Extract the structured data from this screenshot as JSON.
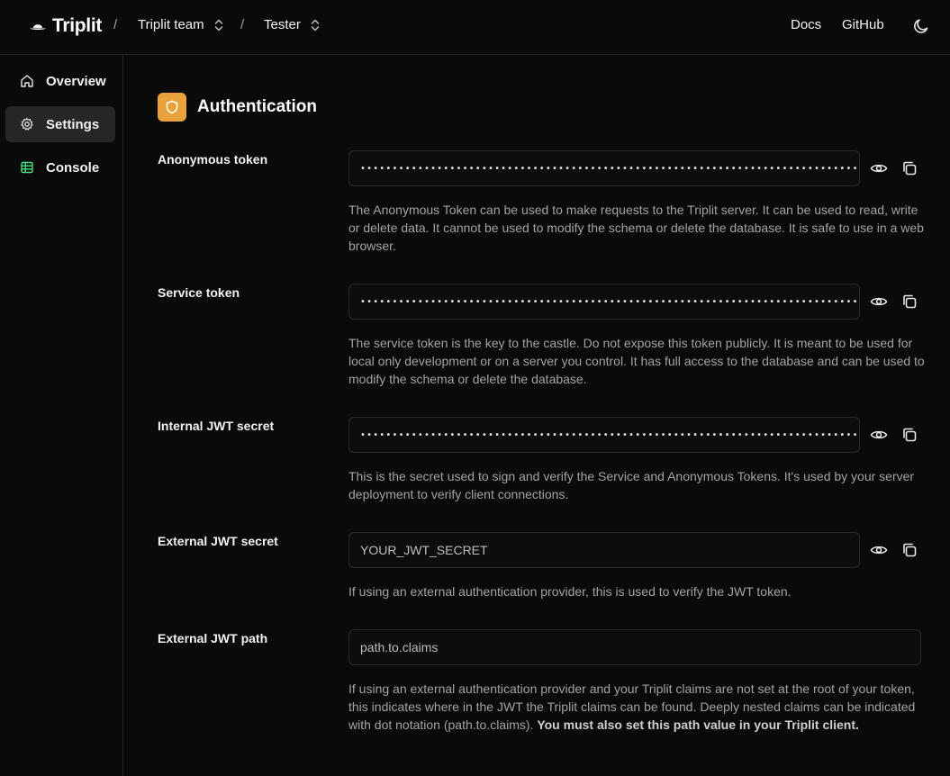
{
  "header": {
    "logo_text": "Triplit",
    "separator": "/",
    "team": "Triplit team",
    "project": "Tester",
    "docs_link": "Docs",
    "github_link": "GitHub"
  },
  "sidebar": {
    "items": [
      {
        "label": "Overview",
        "icon": "home-icon"
      },
      {
        "label": "Settings",
        "icon": "gear-icon",
        "active": true
      },
      {
        "label": "Console",
        "icon": "table-icon"
      }
    ]
  },
  "section": {
    "title": "Authentication",
    "accent_color": "#e9a23b"
  },
  "fields": {
    "anonymous_token": {
      "label": "Anonymous token",
      "masked_value": "••••••••••••••••••••••••••••••••••••••••••••••••••••••••••••••••••••••••••••••••••••••••••••••••••",
      "description": "The Anonymous Token can be used to make requests to the Triplit server. It can be used to read, write or delete data. It cannot be used to modify the schema or delete the database. It is safe to use in a web browser."
    },
    "service_token": {
      "label": "Service token",
      "masked_value": "••••••••••••••••••••••••••••••••••••••••••••••••••••••••••••••••••••••••••••••••••••••••••••••••••",
      "description": "The service token is the key to the castle. Do not expose this token publicly. It is meant to be used for local only development or on a server you control. It has full access to the database and can be used to modify the schema or delete the database."
    },
    "internal_jwt": {
      "label": "Internal JWT secret",
      "masked_value": "••••••••••••••••••••••••••••••••••••••••••••••••••••••••••••••••••••••••••••••••••••••••••••••••••",
      "description": "This is the secret used to sign and verify the Service and Anonymous Tokens. It's used by your server deployment to verify client connections."
    },
    "external_jwt": {
      "label": "External JWT secret",
      "value": "YOUR_JWT_SECRET",
      "description": "If using an external authentication provider, this is used to verify the JWT token."
    },
    "external_jwt_path": {
      "label": "External JWT path",
      "value": "path.to.claims",
      "description": "If using an external authentication provider and your Triplit claims are not set at the root of your token, this indicates where in the JWT the Triplit claims can be found. Deeply nested claims can be indicated with dot notation (path.to.claims). ",
      "description_bold": "You must also set this path value in your Triplit client."
    }
  }
}
